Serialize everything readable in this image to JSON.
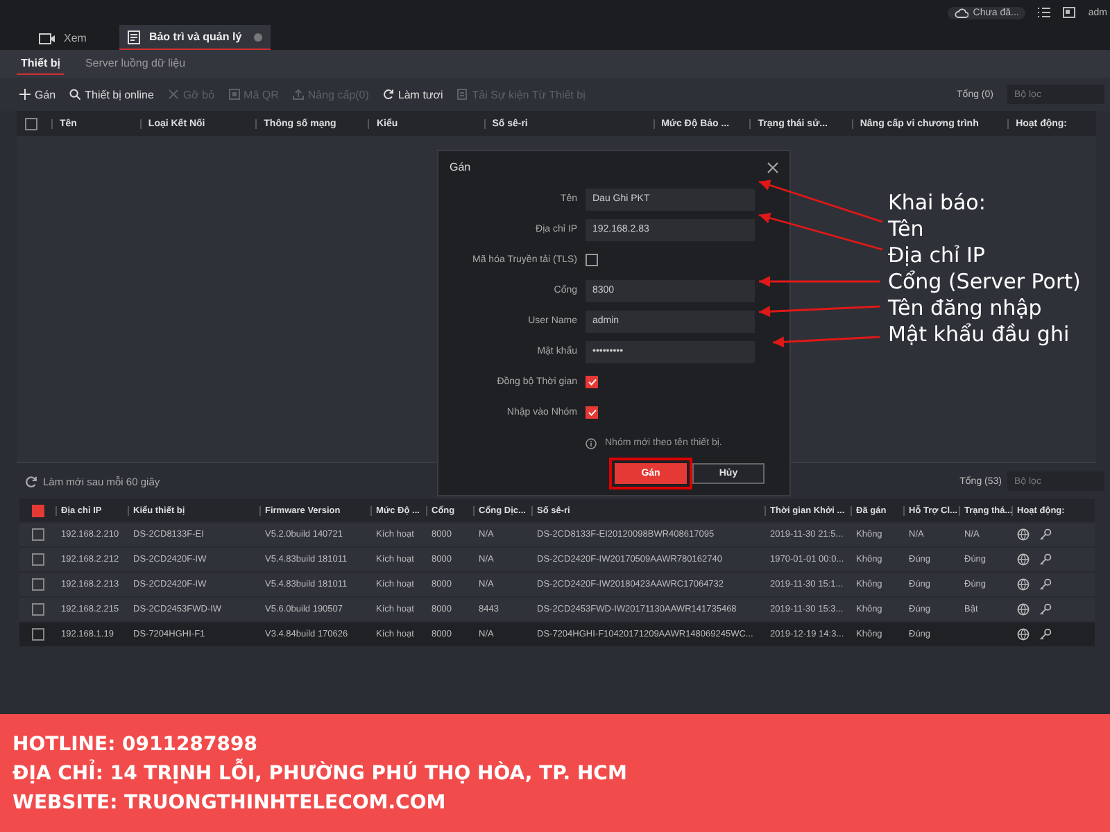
{
  "title_bar": {
    "cloud_status": "Chưa đă...",
    "user": "adm"
  },
  "tabs": [
    {
      "label": "Xem",
      "selected": false,
      "closable": false
    },
    {
      "label": "Bảo trì và quản lý",
      "selected": true,
      "closable": true
    }
  ],
  "sub_tabs": [
    {
      "label": "Thiết bị",
      "selected": true
    },
    {
      "label": "Server luồng dữ liệu",
      "selected": false
    }
  ],
  "toolbar": {
    "buttons": [
      {
        "kind": "add",
        "label": "Gán",
        "disabled": false
      },
      {
        "kind": "search",
        "label": "Thiết bị online",
        "disabled": false
      },
      {
        "kind": "remove",
        "label": "Gỡ bỏ",
        "disabled": true
      },
      {
        "kind": "qr",
        "label": "Mã QR",
        "disabled": true
      },
      {
        "kind": "upgrade",
        "label": "Nâng cấp(0)",
        "disabled": true
      },
      {
        "kind": "refresh",
        "label": "Làm tươi",
        "disabled": false
      },
      {
        "kind": "download",
        "label": "Tải Sự kiện Từ Thiết bị",
        "disabled": true
      }
    ],
    "total": "Tổng (0)",
    "filter_placeholder": "Bộ lọc"
  },
  "device_table": {
    "select_all_checked": false,
    "columns": [
      "Tên",
      "Loại Kết Nối",
      "Thông số mạng",
      "Kiểu",
      "Số sê-ri",
      "Mức Độ Bảo ...",
      "Trạng thái sử...",
      "Nâng cấp vi chương trình",
      "Hoạt động:"
    ]
  },
  "online": {
    "refresh_note": "Làm mới sau mỗi 60 giây",
    "total": "Tổng (53)",
    "filter_placeholder": "Bộ lọc",
    "select_all_partial": true,
    "columns": [
      "Địa chỉ IP",
      "Kiểu thiết bị",
      "Firmware Version",
      "Mức Độ ...",
      "Cổng",
      "Cổng Dịc...",
      "Số sê-ri",
      "Thời gian Khởi ...",
      "Đã gán",
      "Hỗ Trợ Cl...",
      "Trạng thá...",
      "Hoạt động:"
    ],
    "rows": [
      {
        "selected": false,
        "checked": false,
        "cells": [
          "192.168.2.210",
          "DS-2CD8133F-EI",
          "V5.2.0build 140721",
          "Kích hoạt",
          "8000",
          "N/A",
          "DS-2CD8133F-EI20120098BWR408617095",
          "2019-11-30 21:5...",
          "Không",
          "N/A",
          "N/A"
        ]
      },
      {
        "selected": false,
        "checked": false,
        "cells": [
          "192.168.2.212",
          "DS-2CD2420F-IW",
          "V5.4.83build 181011",
          "Kích hoạt",
          "8000",
          "N/A",
          "DS-2CD2420F-IW20170509AAWR780162740",
          "1970-01-01 00:0...",
          "Không",
          "Đúng",
          "Đúng"
        ]
      },
      {
        "selected": false,
        "checked": false,
        "cells": [
          "192.168.2.213",
          "DS-2CD2420F-IW",
          "V5.4.83build 181011",
          "Kích hoạt",
          "8000",
          "N/A",
          "DS-2CD2420F-IW20180423AAWRC17064732",
          "2019-11-30 15:1...",
          "Không",
          "Đúng",
          "Đúng"
        ]
      },
      {
        "selected": false,
        "checked": false,
        "cells": [
          "192.168.2.215",
          "DS-2CD2453FWD-IW",
          "V5.6.0build 190507",
          "Kích hoạt",
          "8000",
          "8443",
          "DS-2CD2453FWD-IW20171130AAWR141735468",
          "2019-11-30 15:3...",
          "Không",
          "Đúng",
          "Bật"
        ]
      },
      {
        "selected": true,
        "checked": false,
        "cells": [
          "192.168.1.19",
          "DS-7204HGHI-F1",
          "V3.4.84build 170626",
          "Kích hoạt",
          "8000",
          "N/A",
          "DS-7204HGHI-F10420171209AAWR148069245WC...",
          "2019-12-19 14:3...",
          "Không",
          "Đúng"
        ]
      }
    ]
  },
  "dialog": {
    "title": "Gán",
    "fields": [
      {
        "kind": "text",
        "label": "Tên",
        "value": "Dau Ghi PKT"
      },
      {
        "kind": "text",
        "label": "Địa chỉ IP",
        "value": "192.168.2.83"
      },
      {
        "kind": "checkbox",
        "label": "Mã hóa Truyền tải (TLS)",
        "checked": false
      },
      {
        "kind": "text",
        "label": "Cổng",
        "value": "8300"
      },
      {
        "kind": "text",
        "label": "User Name",
        "value": "admin"
      },
      {
        "kind": "text",
        "label": "Mật khẩu",
        "value": "•••••••••"
      },
      {
        "kind": "checkbox",
        "label": "Đồng bộ Thời gian",
        "checked": true
      },
      {
        "kind": "checkbox",
        "label": "Nhập vào Nhóm",
        "checked": true
      },
      {
        "kind": "note",
        "text": "Nhóm mới theo tên thiết bị."
      }
    ],
    "buttons": [
      {
        "label": "Gán",
        "primary": true,
        "highlighted": true
      },
      {
        "label": "Hủy",
        "primary": false,
        "highlighted": false
      }
    ]
  },
  "annotations": {
    "heading": "Khai báo:",
    "items": [
      "Tên",
      "Địa chỉ IP",
      "Cổng (Server Port)",
      "Tên đăng nhập",
      "Mật khẩu đầu ghi"
    ]
  },
  "footer": [
    "HOTLINE: 0911287898",
    "ĐỊA CHỈ: 14 TRỊNH LỖI, PHƯỜNG PHÚ THỌ HÒA, TP. HCM",
    "WEBSITE: TRUONGTHINHTELECOM.COM"
  ]
}
